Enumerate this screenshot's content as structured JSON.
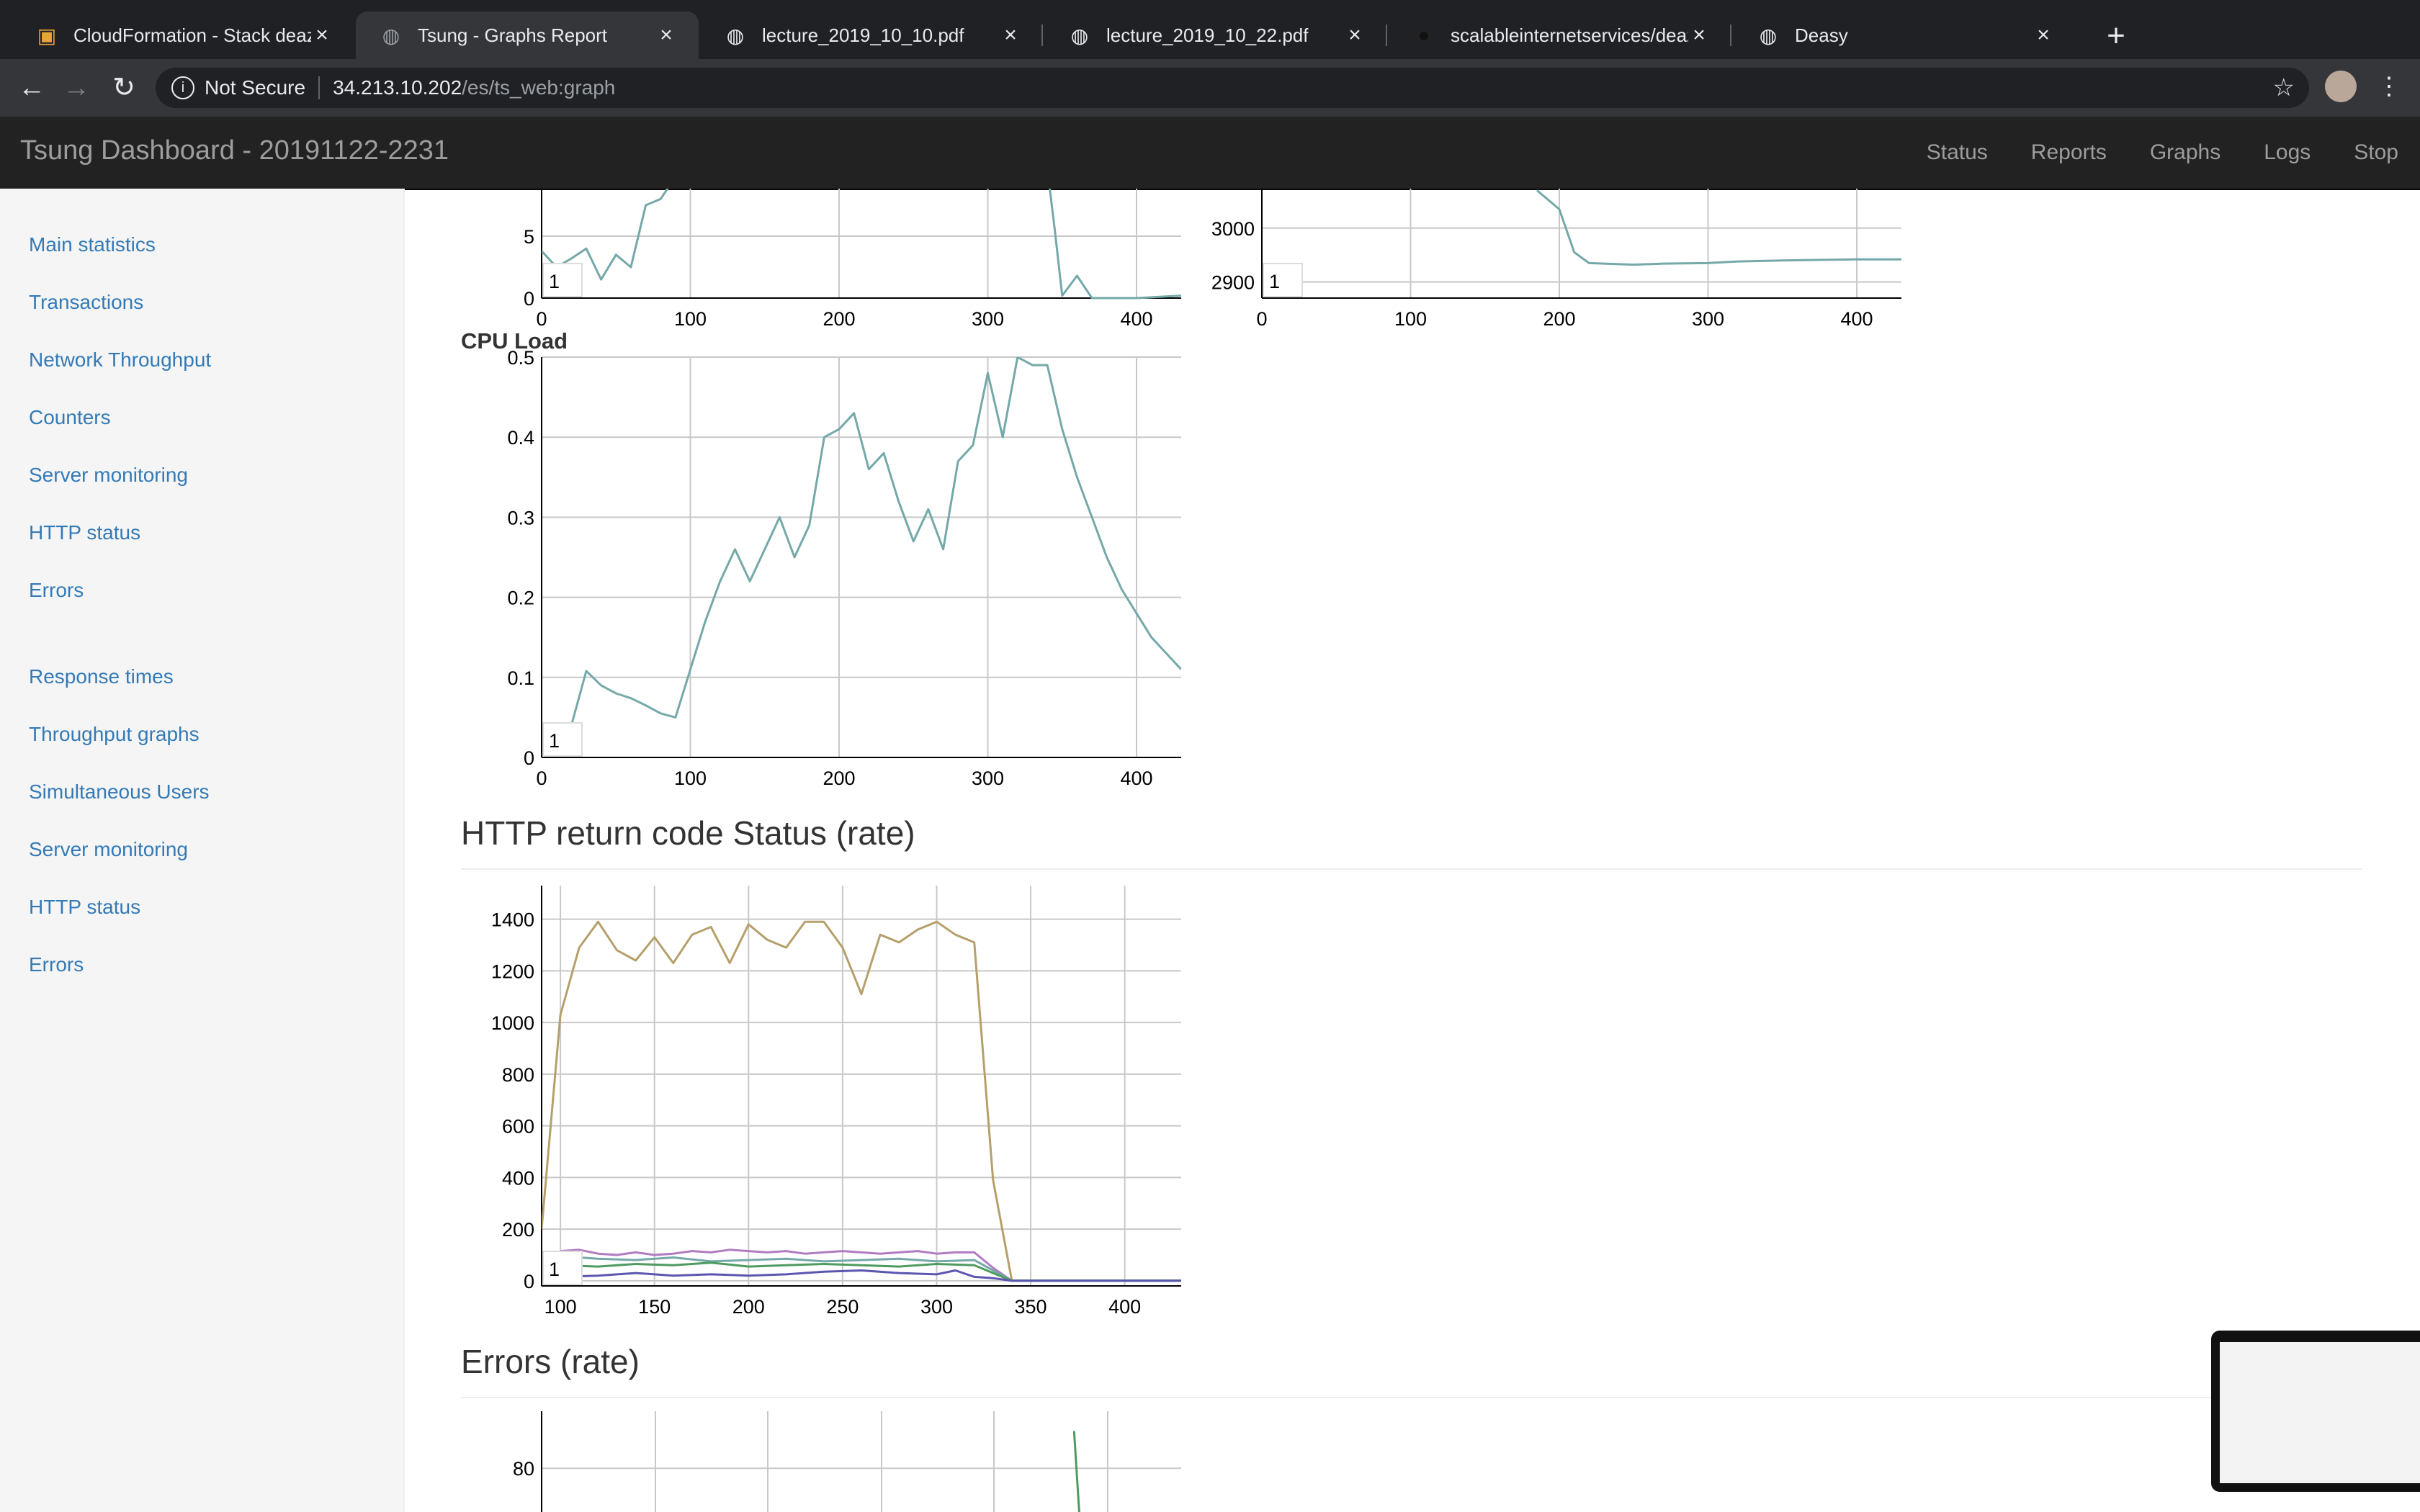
{
  "browser": {
    "tabs": [
      {
        "title": "CloudFormation - Stack deazySt",
        "icon": "aws-box-icon",
        "active": false
      },
      {
        "title": "Tsung - Graphs Report",
        "icon": "globe-icon",
        "active": true
      },
      {
        "title": "lecture_2019_10_10.pdf",
        "icon": "globe-icon",
        "active": false
      },
      {
        "title": "lecture_2019_10_22.pdf",
        "icon": "globe-icon",
        "active": false
      },
      {
        "title": "scalableinternetservices/deazy: I",
        "icon": "github-icon",
        "active": false
      },
      {
        "title": "Deasy",
        "icon": "globe-icon",
        "active": false
      }
    ],
    "security": "Not Secure",
    "url_host": "34.213.10.202",
    "url_path": "/es/ts_web:graph"
  },
  "app": {
    "title": "Tsung Dashboard - 20191122-2231",
    "nav": [
      "Status",
      "Reports",
      "Graphs",
      "Logs",
      "Stop"
    ]
  },
  "sidebar": {
    "group1": [
      "Main statistics",
      "Transactions",
      "Network Throughput",
      "Counters",
      "Server monitoring",
      "HTTP status",
      "Errors"
    ],
    "group2": [
      "Response times",
      "Throughput graphs",
      "Simultaneous Users",
      "Server monitoring",
      "HTTP status",
      "Errors"
    ]
  },
  "sections": {
    "http_title": "HTTP return code Status (rate)",
    "errors_title": "Errors (rate)"
  },
  "colors": {
    "teal": "#75a8a8",
    "tan": "#b5a06b",
    "purple": "#b07bc0",
    "blue": "#5b57b0",
    "green": "#4e9a5f",
    "grid": "#c8c8c8"
  },
  "chart_data": [
    {
      "type": "line",
      "title": "",
      "xlim": [
        0,
        430
      ],
      "ylim": [
        0,
        10
      ],
      "xticks": [
        0,
        100,
        200,
        300,
        400
      ],
      "yticks": [
        0,
        5,
        10
      ],
      "legend": "1",
      "series": [
        {
          "x": [
            0,
            10,
            20,
            30,
            40,
            50,
            60,
            70,
            80,
            90,
            95,
            340,
            345,
            350,
            360,
            370,
            380,
            400,
            430
          ],
          "y": [
            3.8,
            2.5,
            3.2,
            4.0,
            1.5,
            3.5,
            2.5,
            7.5,
            8.0,
            9.8,
            10.5,
            10.5,
            5.5,
            0.2,
            1.8,
            0.0,
            0.0,
            0.0,
            0.2
          ]
        }
      ]
    },
    {
      "type": "line",
      "title": "",
      "xlim": [
        0,
        430
      ],
      "ylim": [
        2870,
        3100
      ],
      "xticks": [
        0,
        100,
        200,
        300,
        400
      ],
      "yticks": [
        2900,
        3000
      ],
      "legend": "1",
      "series": [
        {
          "x": [
            185,
            200,
            210,
            220,
            250,
            270,
            300,
            320,
            350,
            400,
            430
          ],
          "y": [
            3070,
            3035,
            2955,
            2935,
            2932,
            2934,
            2935,
            2938,
            2940,
            2942,
            2942
          ]
        }
      ]
    },
    {
      "type": "line",
      "title": "CPU Load",
      "xlim": [
        0,
        430
      ],
      "ylim": [
        0,
        0.5
      ],
      "xticks": [
        0,
        100,
        200,
        300,
        400
      ],
      "yticks": [
        0,
        0.1,
        0.2,
        0.3,
        0.4,
        0.5
      ],
      "legend": "1",
      "series": [
        {
          "x": [
            20,
            30,
            40,
            50,
            60,
            70,
            80,
            90,
            100,
            110,
            120,
            130,
            140,
            150,
            160,
            170,
            180,
            190,
            200,
            210,
            220,
            230,
            240,
            250,
            260,
            270,
            280,
            290,
            300,
            310,
            320,
            330,
            340,
            350,
            360,
            370,
            380,
            390,
            400,
            410,
            420,
            430
          ],
          "y": [
            0.04,
            0.108,
            0.09,
            0.08,
            0.074,
            0.065,
            0.055,
            0.05,
            0.11,
            0.17,
            0.22,
            0.26,
            0.22,
            0.26,
            0.3,
            0.25,
            0.29,
            0.4,
            0.41,
            0.43,
            0.36,
            0.38,
            0.32,
            0.27,
            0.31,
            0.26,
            0.37,
            0.39,
            0.48,
            0.4,
            0.5,
            0.49,
            0.49,
            0.41,
            0.35,
            0.3,
            0.25,
            0.21,
            0.18,
            0.15,
            0.13,
            0.11
          ]
        }
      ]
    },
    {
      "type": "line",
      "title": "HTTP return code Status (rate)",
      "xlim": [
        90,
        430
      ],
      "ylim": [
        -20,
        1530
      ],
      "xticks": [
        100,
        150,
        200,
        250,
        300,
        350,
        400
      ],
      "yticks": [
        0,
        200,
        400,
        600,
        800,
        1000,
        1200,
        1400
      ],
      "legend": "1",
      "series": [
        {
          "color": "tan",
          "x": [
            90,
            100,
            110,
            120,
            130,
            140,
            150,
            160,
            170,
            180,
            190,
            200,
            210,
            220,
            230,
            240,
            250,
            260,
            270,
            280,
            290,
            300,
            310,
            320,
            330,
            340,
            430
          ],
          "y": [
            200,
            1030,
            1290,
            1390,
            1280,
            1240,
            1330,
            1230,
            1340,
            1370,
            1230,
            1380,
            1320,
            1290,
            1390,
            1390,
            1290,
            1110,
            1340,
            1310,
            1360,
            1390,
            1340,
            1310,
            390,
            0,
            0
          ]
        },
        {
          "color": "purple",
          "x": [
            100,
            110,
            120,
            130,
            140,
            150,
            160,
            170,
            180,
            190,
            200,
            210,
            220,
            230,
            240,
            250,
            260,
            270,
            280,
            290,
            300,
            310,
            320,
            330,
            340,
            430
          ],
          "y": [
            115,
            120,
            105,
            100,
            110,
            100,
            105,
            115,
            110,
            120,
            115,
            110,
            115,
            105,
            110,
            115,
            110,
            105,
            110,
            115,
            105,
            110,
            110,
            50,
            0,
            0
          ]
        },
        {
          "color": "teal",
          "x": [
            100,
            120,
            140,
            160,
            180,
            200,
            220,
            240,
            260,
            280,
            300,
            320,
            330,
            340,
            430
          ],
          "y": [
            95,
            85,
            80,
            90,
            75,
            80,
            85,
            75,
            80,
            85,
            75,
            80,
            40,
            0,
            0
          ]
        },
        {
          "color": "green",
          "x": [
            100,
            120,
            140,
            160,
            180,
            200,
            220,
            240,
            260,
            280,
            300,
            320,
            330,
            340,
            430
          ],
          "y": [
            60,
            55,
            65,
            60,
            70,
            55,
            60,
            65,
            60,
            55,
            65,
            60,
            30,
            0,
            0
          ]
        },
        {
          "color": "blue",
          "x": [
            100,
            120,
            140,
            160,
            180,
            200,
            220,
            240,
            260,
            280,
            300,
            310,
            320,
            330,
            340,
            430
          ],
          "y": [
            15,
            20,
            30,
            20,
            25,
            20,
            25,
            35,
            40,
            30,
            25,
            40,
            15,
            10,
            0,
            0
          ]
        }
      ]
    },
    {
      "type": "line",
      "title": "Errors (rate)",
      "xlim": [
        0,
        430
      ],
      "ylim": [
        0,
        100
      ],
      "xticks": [],
      "yticks": [
        80
      ],
      "series": [
        {
          "color": "green",
          "x": [
            358,
            362
          ],
          "y": [
            93,
            60
          ]
        }
      ]
    }
  ]
}
